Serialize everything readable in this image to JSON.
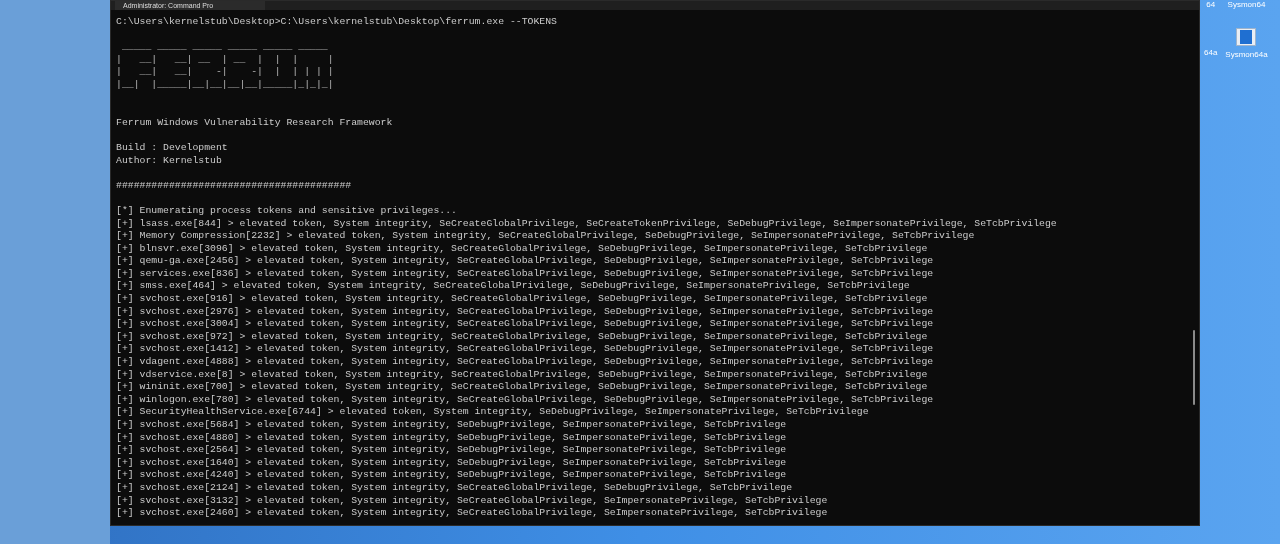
{
  "window": {
    "tab_title": "Administrator: Command Pro"
  },
  "desktop_icons": [
    {
      "label": "64"
    },
    {
      "label": "Sysmon64"
    },
    {
      "label": "64a"
    },
    {
      "label": "Sysmon64a"
    }
  ],
  "terminal": {
    "lines": [
      {
        "kind": "command",
        "text": "C:\\Users\\kernelstub\\Desktop>C:\\Users\\kernelstub\\Desktop\\ferrum.exe --TOKENS"
      },
      {
        "kind": "blank"
      },
      {
        "kind": "art",
        "text": " _____ _____ _____ _____ _____ _____"
      },
      {
        "kind": "art",
        "text": "|   __|   __| __  | __  |  |  |     |"
      },
      {
        "kind": "art",
        "text": "|   __|   __|    -|    -|  |  | | | |"
      },
      {
        "kind": "art",
        "text": "|__|  |_____|__|__|__|__|_____|_|_|_|"
      },
      {
        "kind": "blank"
      },
      {
        "kind": "blank"
      },
      {
        "kind": "text",
        "text": "Ferrum Windows Vulnerability Research Framework"
      },
      {
        "kind": "blank"
      },
      {
        "kind": "text",
        "text": "Build : Development"
      },
      {
        "kind": "text",
        "text": "Author: Kernelstub"
      },
      {
        "kind": "blank"
      },
      {
        "kind": "text",
        "text": "########################################"
      },
      {
        "kind": "blank"
      },
      {
        "kind": "text",
        "text": "[*] Enumerating process tokens and sensitive privileges..."
      },
      {
        "kind": "text",
        "text": "[+] lsass.exe[844] > elevated token, System integrity, SeCreateGlobalPrivilege, SeCreateTokenPrivilege, SeDebugPrivilege, SeImpersonatePrivilege, SeTcbPrivilege"
      },
      {
        "kind": "text",
        "text": "[+] Memory Compression[2232] > elevated token, System integrity, SeCreateGlobalPrivilege, SeDebugPrivilege, SeImpersonatePrivilege, SeTcbPrivilege"
      },
      {
        "kind": "text",
        "text": "[+] blnsvr.exe[3096] > elevated token, System integrity, SeCreateGlobalPrivilege, SeDebugPrivilege, SeImpersonatePrivilege, SeTcbPrivilege"
      },
      {
        "kind": "text",
        "text": "[+] qemu-ga.exe[2456] > elevated token, System integrity, SeCreateGlobalPrivilege, SeDebugPrivilege, SeImpersonatePrivilege, SeTcbPrivilege"
      },
      {
        "kind": "text",
        "text": "[+] services.exe[836] > elevated token, System integrity, SeCreateGlobalPrivilege, SeDebugPrivilege, SeImpersonatePrivilege, SeTcbPrivilege"
      },
      {
        "kind": "text",
        "text": "[+] smss.exe[464] > elevated token, System integrity, SeCreateGlobalPrivilege, SeDebugPrivilege, SeImpersonatePrivilege, SeTcbPrivilege"
      },
      {
        "kind": "text",
        "text": "[+] svchost.exe[916] > elevated token, System integrity, SeCreateGlobalPrivilege, SeDebugPrivilege, SeImpersonatePrivilege, SeTcbPrivilege"
      },
      {
        "kind": "text",
        "text": "[+] svchost.exe[2976] > elevated token, System integrity, SeCreateGlobalPrivilege, SeDebugPrivilege, SeImpersonatePrivilege, SeTcbPrivilege"
      },
      {
        "kind": "text",
        "text": "[+] svchost.exe[3004] > elevated token, System integrity, SeCreateGlobalPrivilege, SeDebugPrivilege, SeImpersonatePrivilege, SeTcbPrivilege"
      },
      {
        "kind": "text",
        "text": "[+] svchost.exe[972] > elevated token, System integrity, SeCreateGlobalPrivilege, SeDebugPrivilege, SeImpersonatePrivilege, SeTcbPrivilege"
      },
      {
        "kind": "text",
        "text": "[+] svchost.exe[1412] > elevated token, System integrity, SeCreateGlobalPrivilege, SeDebugPrivilege, SeImpersonatePrivilege, SeTcbPrivilege"
      },
      {
        "kind": "text",
        "text": "[+] vdagent.exe[4888] > elevated token, System integrity, SeCreateGlobalPrivilege, SeDebugPrivilege, SeImpersonatePrivilege, SeTcbPrivilege"
      },
      {
        "kind": "text",
        "text": "[+] vdservice.exe[8] > elevated token, System integrity, SeCreateGlobalPrivilege, SeDebugPrivilege, SeImpersonatePrivilege, SeTcbPrivilege"
      },
      {
        "kind": "text",
        "text": "[+] wininit.exe[700] > elevated token, System integrity, SeCreateGlobalPrivilege, SeDebugPrivilege, SeImpersonatePrivilege, SeTcbPrivilege"
      },
      {
        "kind": "text",
        "text": "[+] winlogon.exe[780] > elevated token, System integrity, SeCreateGlobalPrivilege, SeDebugPrivilege, SeImpersonatePrivilege, SeTcbPrivilege"
      },
      {
        "kind": "text",
        "text": "[+] SecurityHealthService.exe[6744] > elevated token, System integrity, SeDebugPrivilege, SeImpersonatePrivilege, SeTcbPrivilege"
      },
      {
        "kind": "text",
        "text": "[+] svchost.exe[5684] > elevated token, System integrity, SeDebugPrivilege, SeImpersonatePrivilege, SeTcbPrivilege"
      },
      {
        "kind": "text",
        "text": "[+] svchost.exe[4880] > elevated token, System integrity, SeDebugPrivilege, SeImpersonatePrivilege, SeTcbPrivilege"
      },
      {
        "kind": "text",
        "text": "[+] svchost.exe[2564] > elevated token, System integrity, SeDebugPrivilege, SeImpersonatePrivilege, SeTcbPrivilege"
      },
      {
        "kind": "text",
        "text": "[+] svchost.exe[1640] > elevated token, System integrity, SeDebugPrivilege, SeImpersonatePrivilege, SeTcbPrivilege"
      },
      {
        "kind": "text",
        "text": "[+] svchost.exe[4240] > elevated token, System integrity, SeDebugPrivilege, SeImpersonatePrivilege, SeTcbPrivilege"
      },
      {
        "kind": "text",
        "text": "[+] svchost.exe[2124] > elevated token, System integrity, SeCreateGlobalPrivilege, SeDebugPrivilege, SeTcbPrivilege"
      },
      {
        "kind": "text",
        "text": "[+] svchost.exe[3132] > elevated token, System integrity, SeCreateGlobalPrivilege, SeImpersonatePrivilege, SeTcbPrivilege"
      },
      {
        "kind": "text",
        "text": "[+] svchost.exe[2460] > elevated token, System integrity, SeCreateGlobalPrivilege, SeImpersonatePrivilege, SeTcbPrivilege"
      }
    ]
  }
}
